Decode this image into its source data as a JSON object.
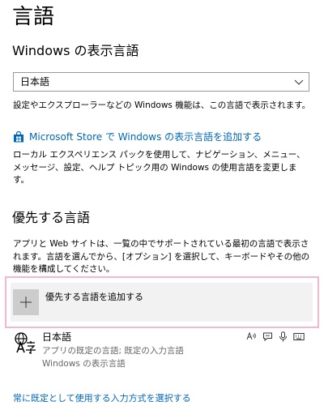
{
  "page": {
    "title": "言語"
  },
  "display_language": {
    "heading": "Windows の表示言語",
    "selected": "日本語",
    "description": "設定やエクスプローラーなどの Windows 機能は、この言語で表示されます。",
    "store_link": "Microsoft Store で Windows の表示言語を追加する",
    "store_description": "ローカル エクスペリエンス パックを使用して、ナビゲーション、メニュー、メッセージ、設定、ヘルプ トピック用の Windows の使用言語を変更します。"
  },
  "preferred_languages": {
    "heading": "優先する言語",
    "description": "アプリと Web サイトは、一覧の中でサポートされている最初の言語で表示されます。言語を選んでから、[オプション] を選択して、キーボードやその他の機能を構成してください。",
    "add_button_label": "優先する言語を追加する",
    "items": [
      {
        "name": "日本語",
        "line1": "アプリの既定の言語; 既定の入力言語",
        "line2": "Windows の表示言語",
        "feature_icons": [
          "text-to-speech-icon",
          "speech-icon",
          "microphone-icon",
          "keyboard-icon"
        ]
      }
    ]
  },
  "footer": {
    "default_input_link": "常に既定として使用する入力方式を選択する"
  },
  "colors": {
    "link": "#0067b8",
    "focus_ring": "#f2b8d2",
    "button_bg": "#f2f2f2",
    "plus_box_bg": "#cccccc"
  }
}
